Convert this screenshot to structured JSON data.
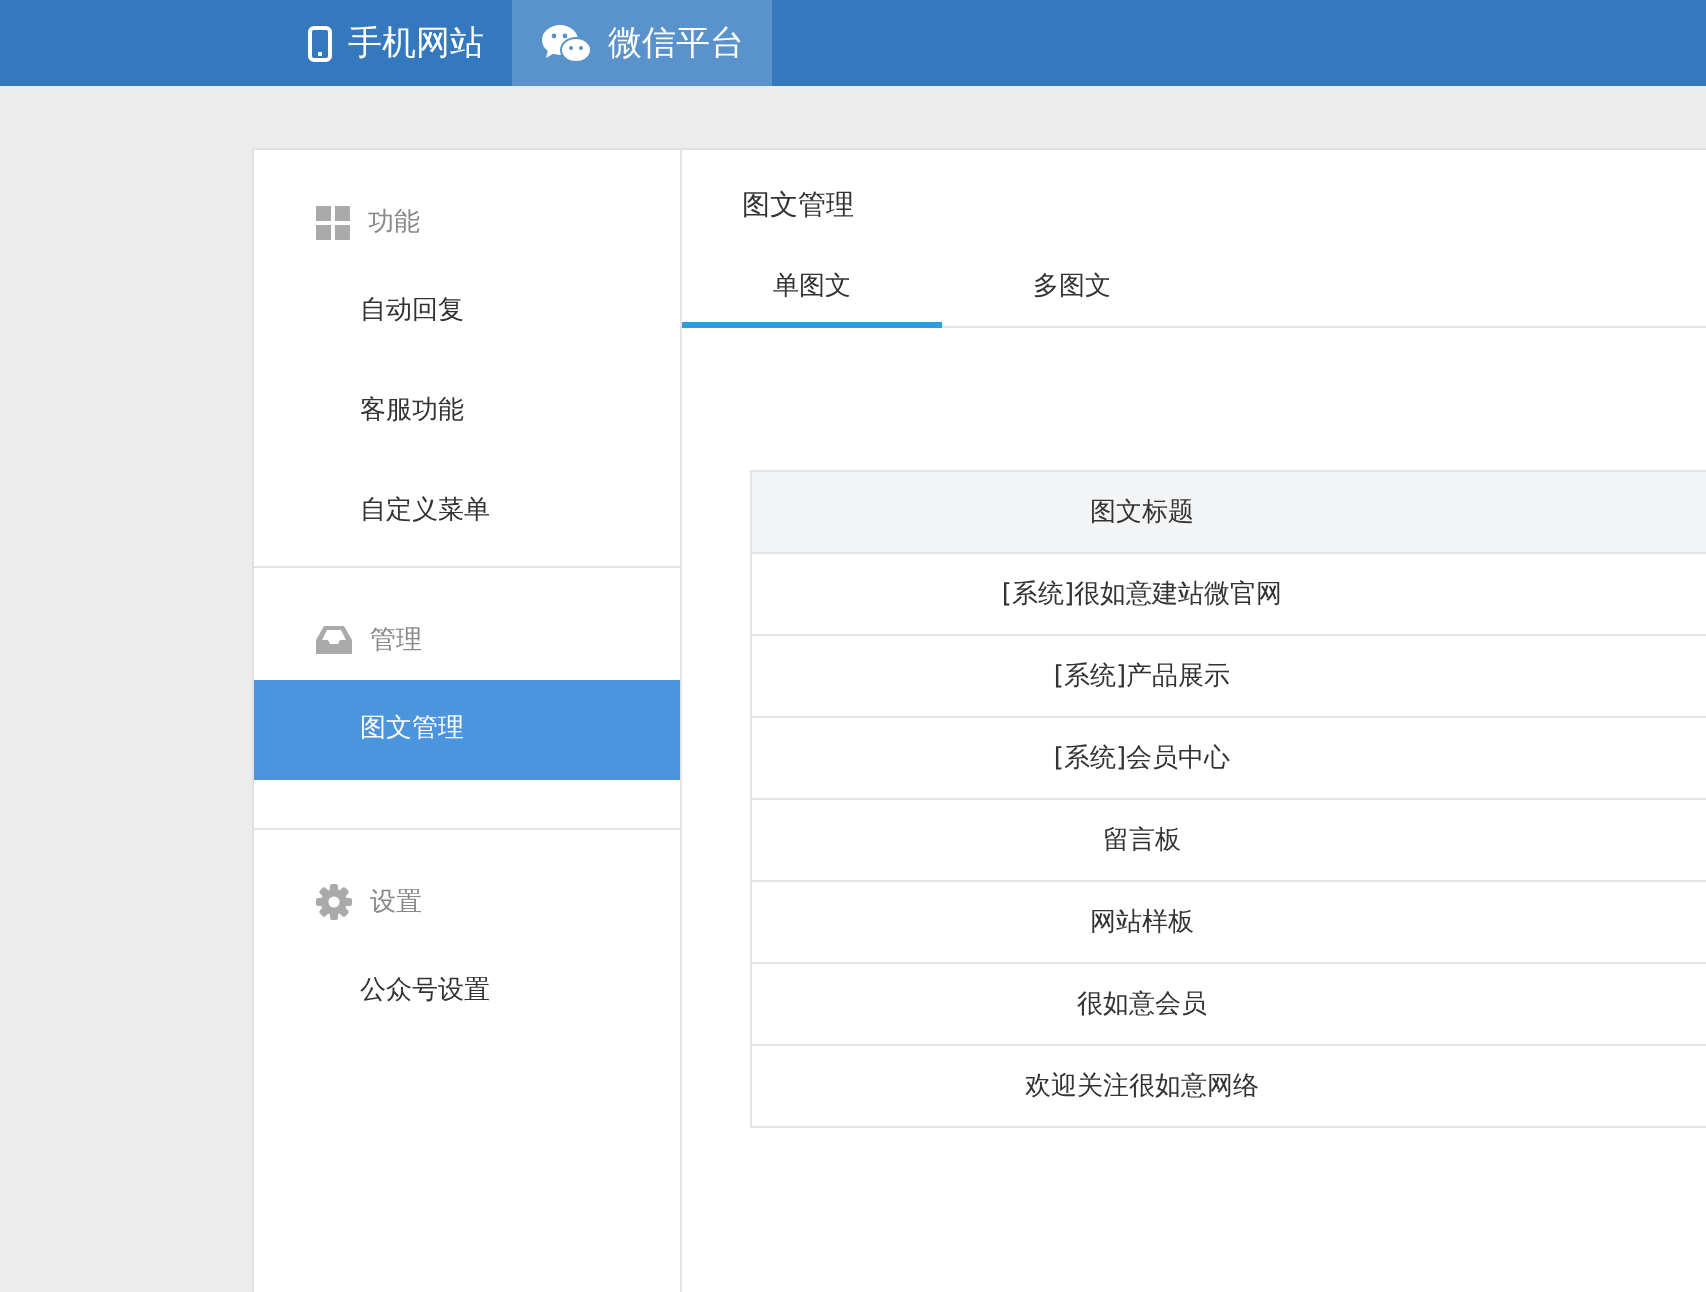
{
  "top_nav": [
    {
      "label": "手机网站",
      "selected": false
    },
    {
      "label": "微信平台",
      "selected": true
    }
  ],
  "sidebar": {
    "groups": [
      {
        "title": "功能",
        "items": [
          {
            "label": "自动回复",
            "selected": false
          },
          {
            "label": "客服功能",
            "selected": false
          },
          {
            "label": "自定义菜单",
            "selected": false
          }
        ]
      },
      {
        "title": "管理",
        "items": [
          {
            "label": "图文管理",
            "selected": true
          }
        ]
      },
      {
        "title": "设置",
        "items": [
          {
            "label": "公众号设置",
            "selected": false
          }
        ]
      }
    ]
  },
  "content": {
    "title": "图文管理",
    "tabs": [
      {
        "label": "单图文",
        "selected": true
      },
      {
        "label": "多图文",
        "selected": false
      }
    ],
    "table": {
      "columns": [
        "图文标题"
      ],
      "rows": [
        [
          "[系统]很如意建站微官网"
        ],
        [
          "[系统]产品展示"
        ],
        [
          "[系统]会员中心"
        ],
        [
          "留言板"
        ],
        [
          "网站样板"
        ],
        [
          "很如意会员"
        ],
        [
          "欢迎关注很如意网络"
        ]
      ]
    }
  }
}
